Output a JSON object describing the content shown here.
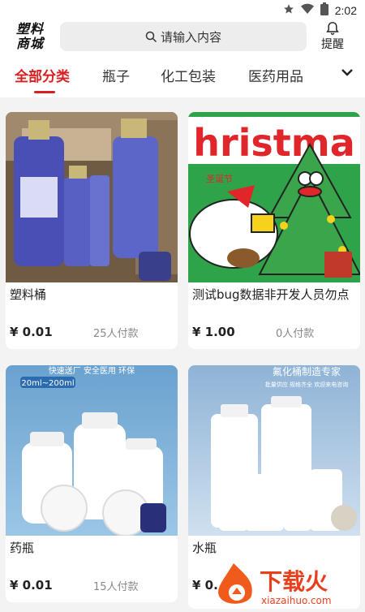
{
  "status_bar": {
    "time": "2:02",
    "icons": [
      "star-icon",
      "wifi-icon",
      "battery-icon"
    ]
  },
  "header": {
    "logo_line1": "塑料",
    "logo_line2": "商城",
    "search_placeholder": "请输入内容",
    "remind_label": "提醒"
  },
  "tabs": [
    {
      "label": "全部分类",
      "active": true
    },
    {
      "label": "瓶子",
      "active": false
    },
    {
      "label": "化工包装",
      "active": false
    },
    {
      "label": "医药用品",
      "active": false
    }
  ],
  "products": [
    {
      "title": "塑料桶",
      "price": "¥ 0.01",
      "paid": "25人付款"
    },
    {
      "title": "测试bug数据非开发人员勿点",
      "price": "¥ 1.00",
      "paid": "0人付款"
    },
    {
      "title": "药瓶",
      "price": "¥ 0.01",
      "paid": "15人付款"
    },
    {
      "title": "水瓶",
      "price": "¥ 0.",
      "paid": ""
    }
  ],
  "images": {
    "christmas_text": "hristma",
    "christmas_sub": "圣诞节",
    "medicine_banner": "20ml~200ml",
    "medicine_top": "快速送厂 安全医用 环保",
    "water_banner": "氟化桶制造专家",
    "water_sub": "批量供应 规格齐全 欢迎来电咨询"
  },
  "watermark": {
    "name": "下载火",
    "url": "xiazaihuo.com"
  },
  "colors": {
    "accent": "#d91f1f",
    "christmas_red": "#e0252b",
    "christmas_green": "#2fa34a"
  }
}
